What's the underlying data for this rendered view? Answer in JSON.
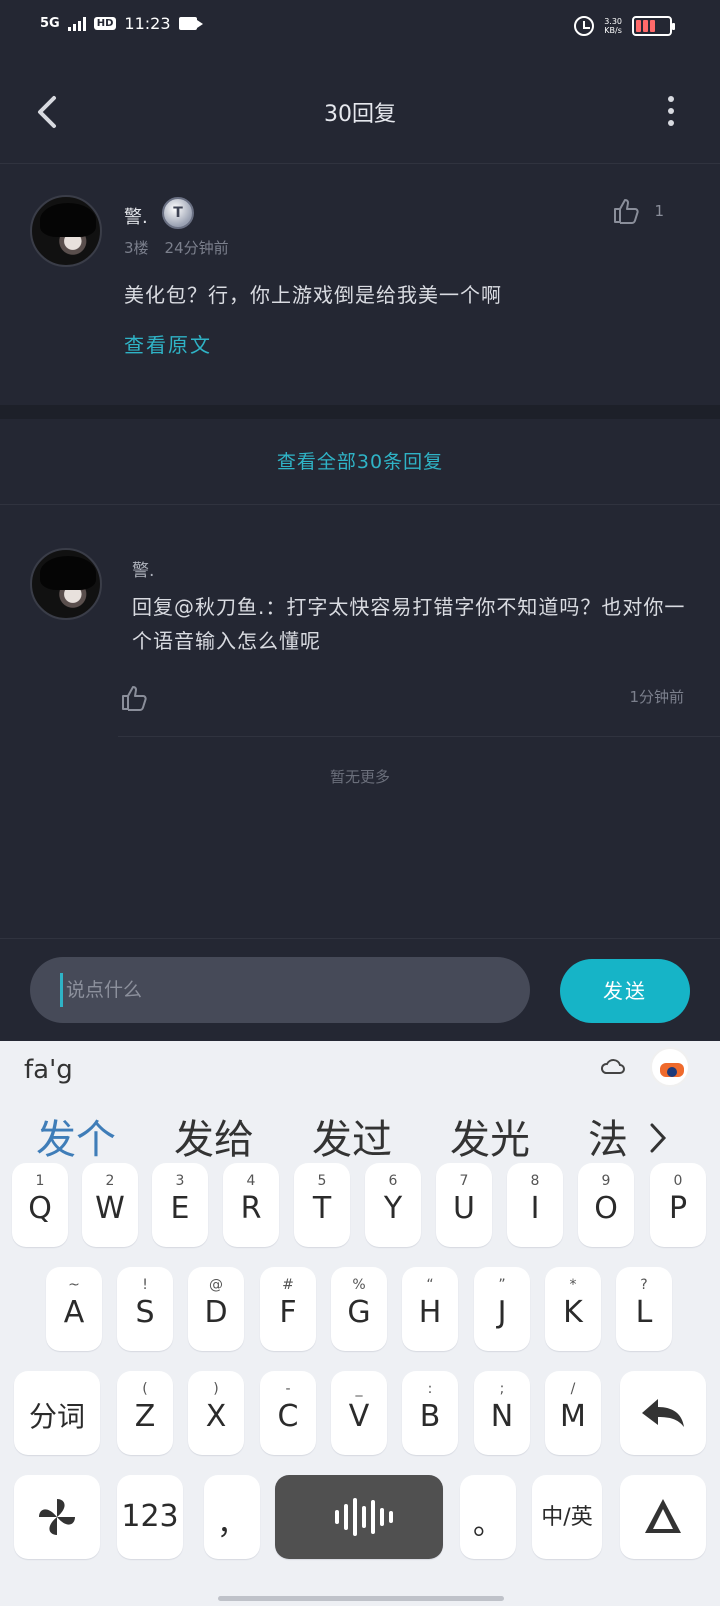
{
  "status_bar": {
    "network": "5G",
    "hd": "HD",
    "time": "11:23",
    "speed": "3.30",
    "speed_unit": "KB/s"
  },
  "header": {
    "title": "30回复"
  },
  "main_comment": {
    "username": "警.",
    "badge": "T",
    "floor": "3楼",
    "time": "24分钟前",
    "like_count": "1",
    "text": "美化包？行，你上游戏倒是给我美一个啊",
    "view_original": "查看原文"
  },
  "view_all": "查看全部30条回复",
  "reply": {
    "username": "警.",
    "text": "回复@秋刀鱼.：打字太快容易打错字你不知道吗？也对你一个语音输入怎么懂呢",
    "time": "1分钟前"
  },
  "no_more": "暂无更多",
  "input": {
    "placeholder": "说点什么",
    "send_label": "发送"
  },
  "keyboard": {
    "composing": "fa'g",
    "candidates": [
      "发个",
      "发给",
      "发过",
      "发光",
      "法"
    ],
    "row1": [
      {
        "sub": "1",
        "main": "Q"
      },
      {
        "sub": "2",
        "main": "W"
      },
      {
        "sub": "3",
        "main": "E"
      },
      {
        "sub": "4",
        "main": "R"
      },
      {
        "sub": "5",
        "main": "T"
      },
      {
        "sub": "6",
        "main": "Y"
      },
      {
        "sub": "7",
        "main": "U"
      },
      {
        "sub": "8",
        "main": "I"
      },
      {
        "sub": "9",
        "main": "O"
      },
      {
        "sub": "0",
        "main": "P"
      }
    ],
    "row2": [
      {
        "sub": "~",
        "main": "A"
      },
      {
        "sub": "!",
        "main": "S"
      },
      {
        "sub": "@",
        "main": "D"
      },
      {
        "sub": "#",
        "main": "F"
      },
      {
        "sub": "%",
        "main": "G"
      },
      {
        "sub": "“",
        "main": "H"
      },
      {
        "sub": "”",
        "main": "J"
      },
      {
        "sub": "*",
        "main": "K"
      },
      {
        "sub": "?",
        "main": "L"
      }
    ],
    "row3": [
      {
        "sub": "(",
        "main": "Z"
      },
      {
        "sub": ")",
        "main": "X"
      },
      {
        "sub": "-",
        "main": "C"
      },
      {
        "sub": "_",
        "main": "V"
      },
      {
        "sub": ":",
        "main": "B"
      },
      {
        "sub": ";",
        "main": "N"
      },
      {
        "sub": "/",
        "main": "M"
      }
    ],
    "segment_label": "分词",
    "num_label": "123",
    "comma": "，",
    "period": "。",
    "lang_toggle": "中/英"
  }
}
